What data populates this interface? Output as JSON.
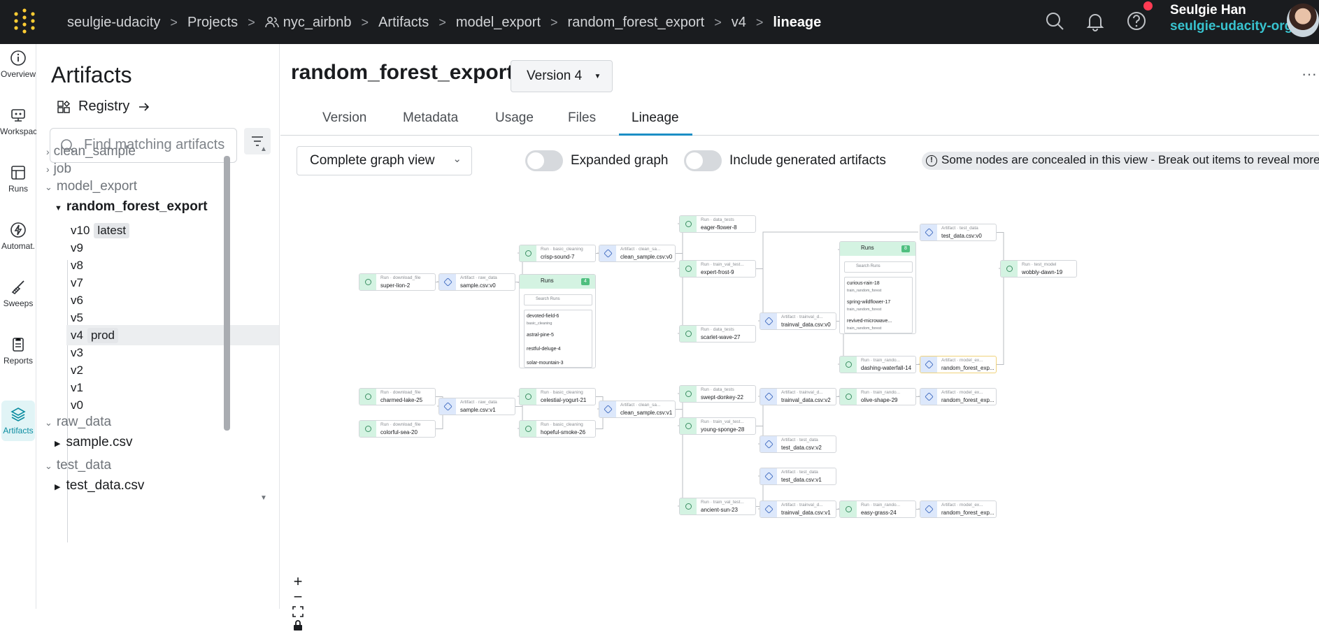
{
  "topbar": {
    "breadcrumbs": [
      "seulgie-udacity",
      "Projects",
      "nyc_airbnb",
      "Artifacts",
      "model_export",
      "random_forest_export",
      "v4",
      "lineage"
    ],
    "user_name": "Seulgie Han",
    "user_org": "seulgie-udacity-org",
    "icons": [
      "logo-icon",
      "search-icon",
      "bell-icon",
      "help-icon",
      "avatar"
    ],
    "notification_color": "#ff3b53"
  },
  "rail": {
    "items": [
      {
        "label": "Overview",
        "icon": "info-icon"
      },
      {
        "label": "Workspace",
        "icon": "workspace-icon"
      },
      {
        "label": "Runs",
        "icon": "table-icon"
      },
      {
        "label": "Automat.",
        "icon": "bolt-icon"
      },
      {
        "label": "Sweeps",
        "icon": "broom-icon"
      },
      {
        "label": "Reports",
        "icon": "report-icon"
      },
      {
        "label": "Artifacts",
        "icon": "layers-icon",
        "active": true
      }
    ],
    "accent_color": "#0b8ca0"
  },
  "sidepanel": {
    "title": "Artifacts",
    "registry_label": "Registry",
    "search_placeholder": "Find matching artifacts",
    "groups_top": [
      "clean_sample",
      "job",
      "model_export"
    ],
    "open_artifact": "random_forest_export",
    "versions": [
      {
        "name": "v10",
        "tag": "latest"
      },
      {
        "name": "v9",
        "tag": ""
      },
      {
        "name": "v8",
        "tag": ""
      },
      {
        "name": "v7",
        "tag": ""
      },
      {
        "name": "v6",
        "tag": ""
      },
      {
        "name": "v5",
        "tag": ""
      },
      {
        "name": "v4",
        "tag": "prod",
        "selected": true
      },
      {
        "name": "v3",
        "tag": ""
      },
      {
        "name": "v2",
        "tag": ""
      },
      {
        "name": "v1",
        "tag": ""
      },
      {
        "name": "v0",
        "tag": ""
      }
    ],
    "groups_bottom": [
      {
        "name": "raw_data",
        "child": "sample.csv"
      },
      {
        "name": "test_data",
        "child": "test_data.csv"
      }
    ]
  },
  "main": {
    "title": "random_forest_export",
    "version_label": "Version 4",
    "more_label": "···",
    "tabs": [
      "Version",
      "Metadata",
      "Usage",
      "Files",
      "Lineage"
    ],
    "active_tab": "Lineage",
    "graph_view": "Complete graph view",
    "toggle_expanded": "Expanded graph",
    "toggle_generated": "Include generated artifacts",
    "notice": "Some nodes are concealed in this view - Break out items to reveal more.",
    "tab_accent": "#1b8ec5"
  },
  "graph": {
    "nodes": [
      {
        "id": "super-lion",
        "kind": "run",
        "type": "Run · download_file",
        "name": "super-lion-2"
      },
      {
        "id": "sample-v0",
        "kind": "art",
        "type": "Artifact · raw_data",
        "name": "sample.csv:v0"
      },
      {
        "id": "crisp-sound",
        "kind": "run",
        "type": "Run · basic_cleaning",
        "name": "crisp-sound-7"
      },
      {
        "id": "clean-v0",
        "kind": "art",
        "type": "Artifact · clean_sa...",
        "name": "clean_sample.csv:v0"
      },
      {
        "id": "eager-flower",
        "kind": "run",
        "type": "Run · data_tests",
        "name": "eager-flower-8"
      },
      {
        "id": "expert-frost",
        "kind": "run",
        "type": "Run · train_val_test...",
        "name": "expert-frost-9"
      },
      {
        "id": "scarlet-wave",
        "kind": "run",
        "type": "Run · data_tests",
        "name": "scarlet-wave-27"
      },
      {
        "id": "trainval-v0",
        "kind": "art",
        "type": "Artifact · trainval_d...",
        "name": "trainval_data.csv:v0"
      },
      {
        "id": "test-v0",
        "kind": "art",
        "type": "Artifact · test_data",
        "name": "test_data.csv:v0"
      },
      {
        "id": "wobbly-dawn",
        "kind": "run",
        "type": "Run · test_model",
        "name": "wobbly-dawn-19"
      },
      {
        "id": "dashing-waterfall",
        "kind": "run",
        "type": "Run · train_rando...",
        "name": "dashing-waterfall-14"
      },
      {
        "id": "rf-export-a",
        "kind": "art",
        "type": "Artifact · model_ex...",
        "name": "random_forest_exp...",
        "highlight": true
      },
      {
        "id": "charmed-lake",
        "kind": "run",
        "type": "Run · download_file",
        "name": "charmed-lake-25"
      },
      {
        "id": "colorful-sea",
        "kind": "run",
        "type": "Run · download_file",
        "name": "colorful-sea-20"
      },
      {
        "id": "sample-v1",
        "kind": "art",
        "type": "Artifact · raw_data",
        "name": "sample.csv:v1"
      },
      {
        "id": "celestial-yogurt",
        "kind": "run",
        "type": "Run · basic_cleaning",
        "name": "celestial-yogurt-21"
      },
      {
        "id": "hopeful-smoke",
        "kind": "run",
        "type": "Run · basic_cleaning",
        "name": "hopeful-smoke-26"
      },
      {
        "id": "clean-v1",
        "kind": "art",
        "type": "Artifact · clean_sa...",
        "name": "clean_sample.csv:v1"
      },
      {
        "id": "swept-donkey",
        "kind": "run",
        "type": "Run · data_tests",
        "name": "swept-donkey-22"
      },
      {
        "id": "young-sponge",
        "kind": "run",
        "type": "Run · train_val_test...",
        "name": "young-sponge-28"
      },
      {
        "id": "trainval-v2",
        "kind": "art",
        "type": "Artifact · trainval_d...",
        "name": "trainval_data.csv:v2"
      },
      {
        "id": "test-v2",
        "kind": "art",
        "type": "Artifact · test_data",
        "name": "test_data.csv:v2"
      },
      {
        "id": "olive-shape",
        "kind": "run",
        "type": "Run · train_rando...",
        "name": "olive-shape-29"
      },
      {
        "id": "rf-export-b",
        "kind": "art",
        "type": "Artifact · model_ex...",
        "name": "random_forest_exp..."
      },
      {
        "id": "test-v1",
        "kind": "art",
        "type": "Artifact · test_data",
        "name": "test_data.csv:v1"
      },
      {
        "id": "ancient-sun",
        "kind": "run",
        "type": "Run · train_val_test...",
        "name": "ancient-sun-23"
      },
      {
        "id": "trainval-v1",
        "kind": "art",
        "type": "Artifact · trainval_d...",
        "name": "trainval_data.csv:v1"
      },
      {
        "id": "easy-grass",
        "kind": "run",
        "type": "Run · train_rando...",
        "name": "easy-grass-24"
      },
      {
        "id": "rf-export-c",
        "kind": "art",
        "type": "Artifact · model_ex...",
        "name": "random_forest_exp..."
      }
    ],
    "runs_groups": [
      {
        "id": "runs-a",
        "label": "Runs",
        "count": "4",
        "search": "Search Runs",
        "items": [
          {
            "name": "devoted-field-6",
            "sub": "basic_cleaning"
          },
          {
            "name": "astral-pine-5",
            "sub": ""
          },
          {
            "name": "restful-deluge-4",
            "sub": ""
          },
          {
            "name": "solar-mountain-3",
            "sub": ""
          }
        ]
      },
      {
        "id": "runs-b",
        "label": "Runs",
        "count": "8",
        "search": "Search Runs",
        "items": [
          {
            "name": "curious-rain-18",
            "sub": "train_random_forest"
          },
          {
            "name": "spring-wildflower-17",
            "sub": "train_random_forest"
          },
          {
            "name": "revived-microwave...",
            "sub": "train_random_forest"
          }
        ]
      }
    ],
    "zoom_controls": [
      "+",
      "−",
      "⛶",
      "🔒"
    ]
  }
}
